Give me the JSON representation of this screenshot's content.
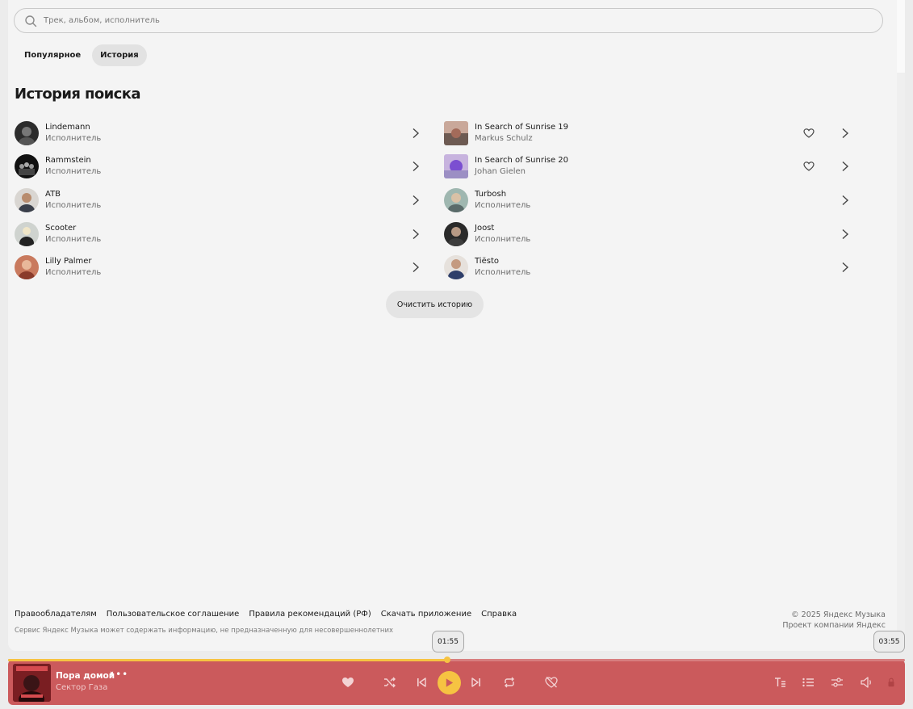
{
  "search": {
    "placeholder": "Трек, альбом, исполнитель"
  },
  "tabs": [
    {
      "label": "Популярное",
      "active": false
    },
    {
      "label": "История",
      "active": true
    }
  ],
  "history": {
    "title": "История поиска",
    "left": [
      {
        "title": "Lindemann",
        "subtitle": "Исполнитель"
      },
      {
        "title": "Rammstein",
        "subtitle": "Исполнитель"
      },
      {
        "title": "ATB",
        "subtitle": "Исполнитель"
      },
      {
        "title": "Scooter",
        "subtitle": "Исполнитель"
      },
      {
        "title": "Lilly Palmer",
        "subtitle": "Исполнитель"
      }
    ],
    "right": [
      {
        "title": "In Search of Sunrise 19",
        "subtitle": "Markus Schulz"
      },
      {
        "title": "In Search of Sunrise 20",
        "subtitle": "Johan Gielen"
      },
      {
        "title": "Turbosh",
        "subtitle": "Исполнитель"
      },
      {
        "title": "Joost",
        "subtitle": "Исполнитель"
      },
      {
        "title": "Tiësto",
        "subtitle": "Исполнитель"
      }
    ],
    "clear_label": "Очистить историю"
  },
  "footer": {
    "links": [
      "Правообладателям",
      "Пользовательское соглашение",
      "Правила рекомендаций (РФ)",
      "Скачать приложение",
      "Справка"
    ],
    "note": "Сервис Яндекс Музыка может содержать информацию, не предназначенную для несовершеннолетних",
    "copyright": "© 2025  Яндекс Музыка",
    "company": "Проект компании Яндекс"
  },
  "player": {
    "track_title": "Пора домой",
    "artist": "Сектор Газа",
    "current_time": "01:55",
    "total_time": "03:55",
    "progress": 0.49,
    "colors": {
      "bar": "#cb5a5c",
      "accent": "#f6c342"
    }
  }
}
